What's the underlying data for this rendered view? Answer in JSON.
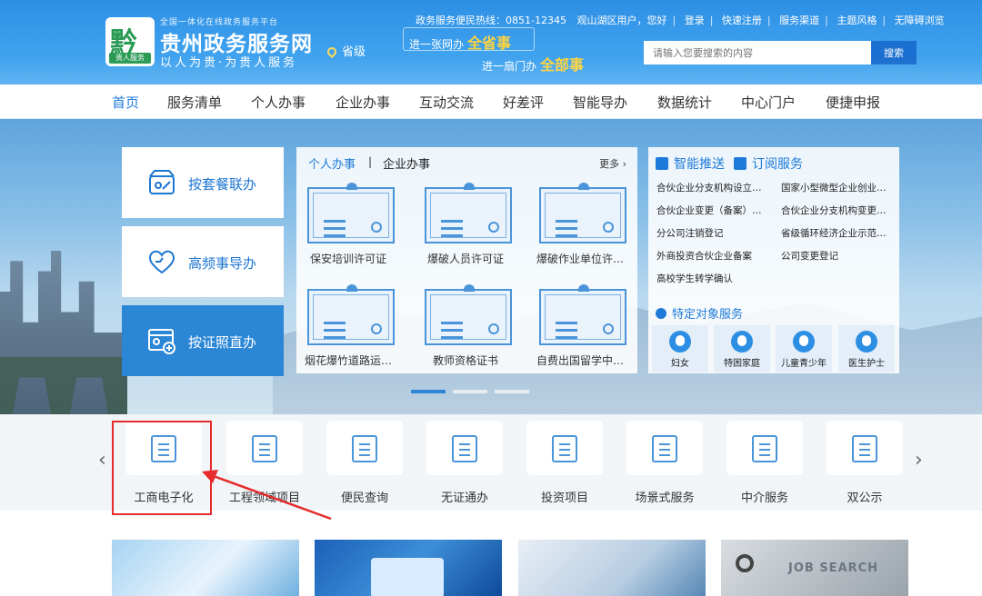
{
  "header": {
    "logo_glyph": "黔",
    "logo_tag": "贵人服务",
    "site_sub": "全国一体化在线政务服务平台",
    "site_title": "贵州政务服务网",
    "site_slogan": "以人为贵·为贵人服务",
    "region": "省级",
    "promo_line1_prefix": "进一张网办",
    "promo_line1_emph": "全省事",
    "promo_line2_prefix": "进一扇门办",
    "promo_line2_emph": "全部事",
    "hotline": "政务服务便民热线：0851-12345",
    "user_greeting": "观山湖区用户，您好",
    "links": [
      "登录",
      "快速注册",
      "服务渠道",
      "主题风格",
      "无障碍浏览"
    ],
    "search_placeholder": "请输入您要搜索的内容",
    "search_button": "搜索"
  },
  "nav": {
    "items": [
      "首页",
      "服务清单",
      "个人办事",
      "企业办事",
      "互动交流",
      "好差评",
      "智能导办",
      "数据统计",
      "中心门户",
      "便捷申报"
    ],
    "active_index": 0
  },
  "hero": {
    "quick_cards": [
      "按套餐联办",
      "高频事导办",
      "按证照直办"
    ],
    "active_quick_card": 2,
    "panel": {
      "tab_personal": "个人办事",
      "tab_sep": "|",
      "tab_enterprise": "企业办事",
      "more": "更多 ›",
      "certs": [
        "保安培训许可证",
        "爆破人员许可证",
        "爆破作业单位许…",
        "烟花爆竹道路运…",
        "教师资格证书",
        "自费出国留学中…"
      ]
    },
    "right_panel": {
      "head_push": "智能推送",
      "head_subscribe": "订阅服务",
      "items": [
        "合伙企业分支机构设立…",
        "国家小型微型企业创业…",
        "合伙企业变更（备案）…",
        "合伙企业分支机构变更…",
        "分公司注销登记",
        "省级循环经济企业示范…",
        "外商投资合伙企业备案",
        "公司变更登记",
        "高校学生转学确认"
      ],
      "special_title": "特定对象服务",
      "targets": [
        "妇女",
        "特困家庭",
        "儿童青少年",
        "医生护士"
      ]
    },
    "slider_active": 0,
    "slider_count": 3
  },
  "services": {
    "items": [
      "工商电子化",
      "工程领域项目",
      "便民查询",
      "无证通办",
      "投资项目",
      "场景式服务",
      "中介服务",
      "双公示"
    ],
    "highlighted_index": 0,
    "prev": "‹",
    "next": "›"
  },
  "thumbs": {
    "job_search": "JOB SEARCH"
  },
  "colors": {
    "header_blue": "#2d8fe4",
    "accent": "#1e7ad8",
    "highlight_red": "#e52b2b"
  }
}
